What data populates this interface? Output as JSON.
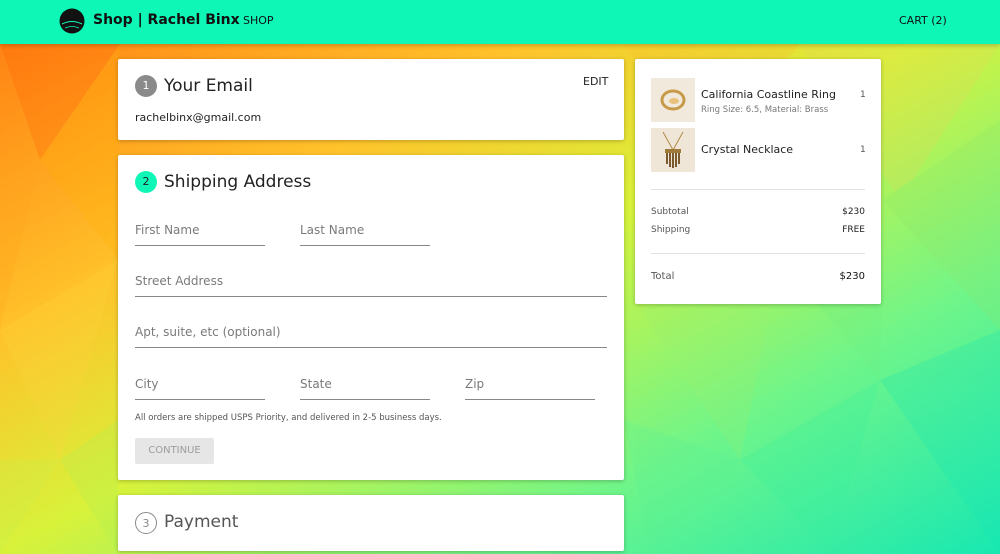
{
  "header": {
    "brand": "Shop | Rachel Binx",
    "nav_shop": "SHOP",
    "nav_cart": "CART (2)"
  },
  "email_section": {
    "step": "1",
    "title": "Your Email",
    "edit_label": "EDIT",
    "email": "rachelbinx@gmail.com"
  },
  "shipping_section": {
    "step": "2",
    "title": "Shipping Address",
    "fields": {
      "first_name": "First Name",
      "last_name": "Last Name",
      "street": "Street Address",
      "apt": "Apt, suite, etc (optional)",
      "city": "City",
      "state": "State",
      "zip": "Zip"
    },
    "note": "All orders are shipped USPS Priority, and delivered in 2-5 business days.",
    "continue_label": "CONTINUE"
  },
  "payment_section": {
    "step": "3",
    "title": "Payment"
  },
  "cart": {
    "items": [
      {
        "name": "California Coastline Ring",
        "details": "Ring Size: 6.5, Material: Brass",
        "qty": "1"
      },
      {
        "name": "Crystal Necklace",
        "details": "",
        "qty": "1"
      }
    ],
    "subtotal_label": "Subtotal",
    "subtotal_value": "$230",
    "shipping_label": "Shipping",
    "shipping_value": "FREE",
    "total_label": "Total",
    "total_value": "$230"
  },
  "colors": {
    "header_bg": "#0ff7b7",
    "active_step": "#0ff7b7",
    "inactive_step": "#8a8a8a",
    "disabled_button": "#e6e6e6"
  }
}
